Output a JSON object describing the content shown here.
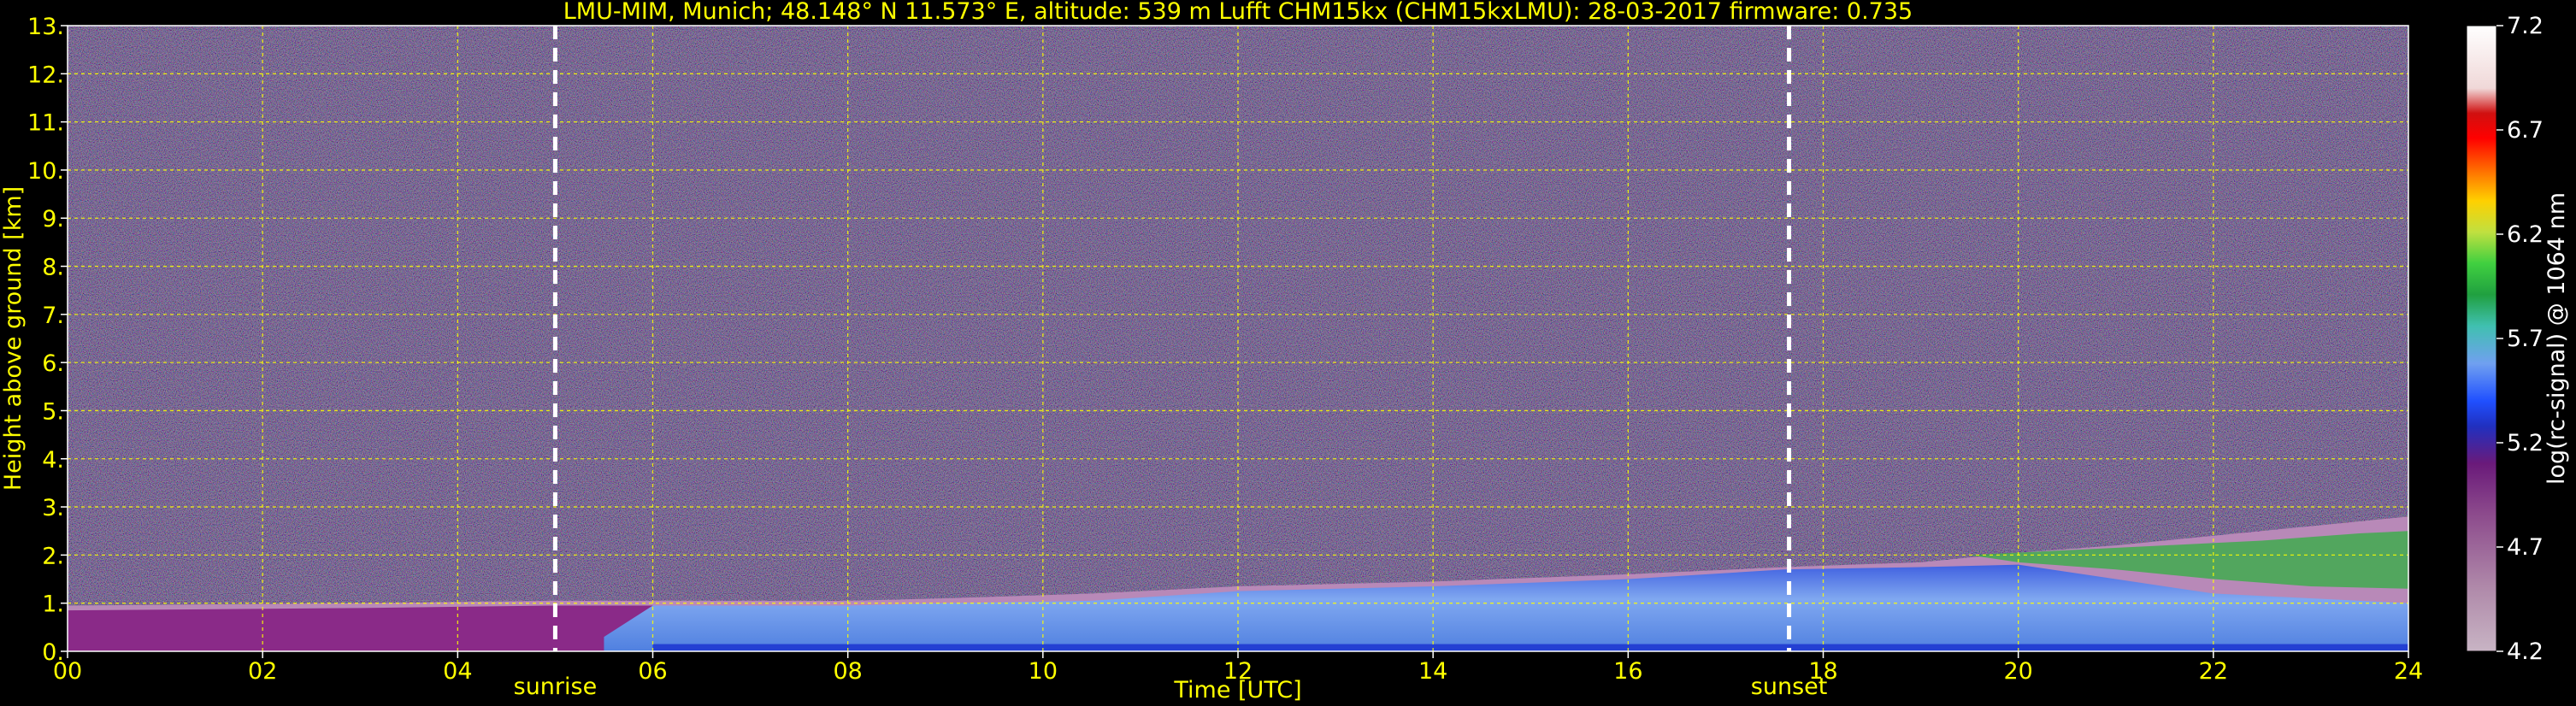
{
  "chart_data": {
    "type": "heatmap",
    "title": "LMU-MIM, Munich; 48.148° N 11.573° E, altitude: 539 m     Lufft CHM15kx (CHM15kxLMU): 28-03-2017     firmware: 0.735",
    "xlabel": "Time [UTC]",
    "ylabel": "Height above ground [km]",
    "xlim": [
      0,
      24
    ],
    "ylim": [
      0,
      13
    ],
    "x_ticks": [
      "00",
      "02",
      "04",
      "06",
      "08",
      "10",
      "12",
      "14",
      "16",
      "18",
      "20",
      "22",
      "24"
    ],
    "y_ticks": [
      "0.",
      "1.",
      "2.",
      "3.",
      "4.",
      "5.",
      "6.",
      "7.",
      "8.",
      "9.",
      "10.",
      "11.",
      "12.",
      "13."
    ],
    "grid": true,
    "colorbar": {
      "label": "log(rc-signal) @ 1064 nm",
      "range": [
        4.2,
        7.2
      ],
      "ticks": [
        "4.2",
        "4.7",
        "5.2",
        "5.7",
        "6.2",
        "6.7",
        "7.2"
      ]
    },
    "events": [
      {
        "label": "sunrise",
        "time_h": 5.0
      },
      {
        "label": "sunset",
        "time_h": 17.65
      }
    ],
    "layers": [
      {
        "t": [
          0,
          3,
          5,
          6,
          8,
          9,
          10.5,
          12,
          14,
          16,
          17.6,
          19,
          20,
          21,
          22,
          23,
          24
        ],
        "top_km": [
          0.95,
          1.0,
          1.05,
          1.05,
          1.05,
          1.1,
          1.2,
          1.35,
          1.45,
          1.6,
          1.75,
          1.85,
          2.05,
          2.2,
          2.4,
          2.6,
          2.8
        ]
      }
    ]
  }
}
